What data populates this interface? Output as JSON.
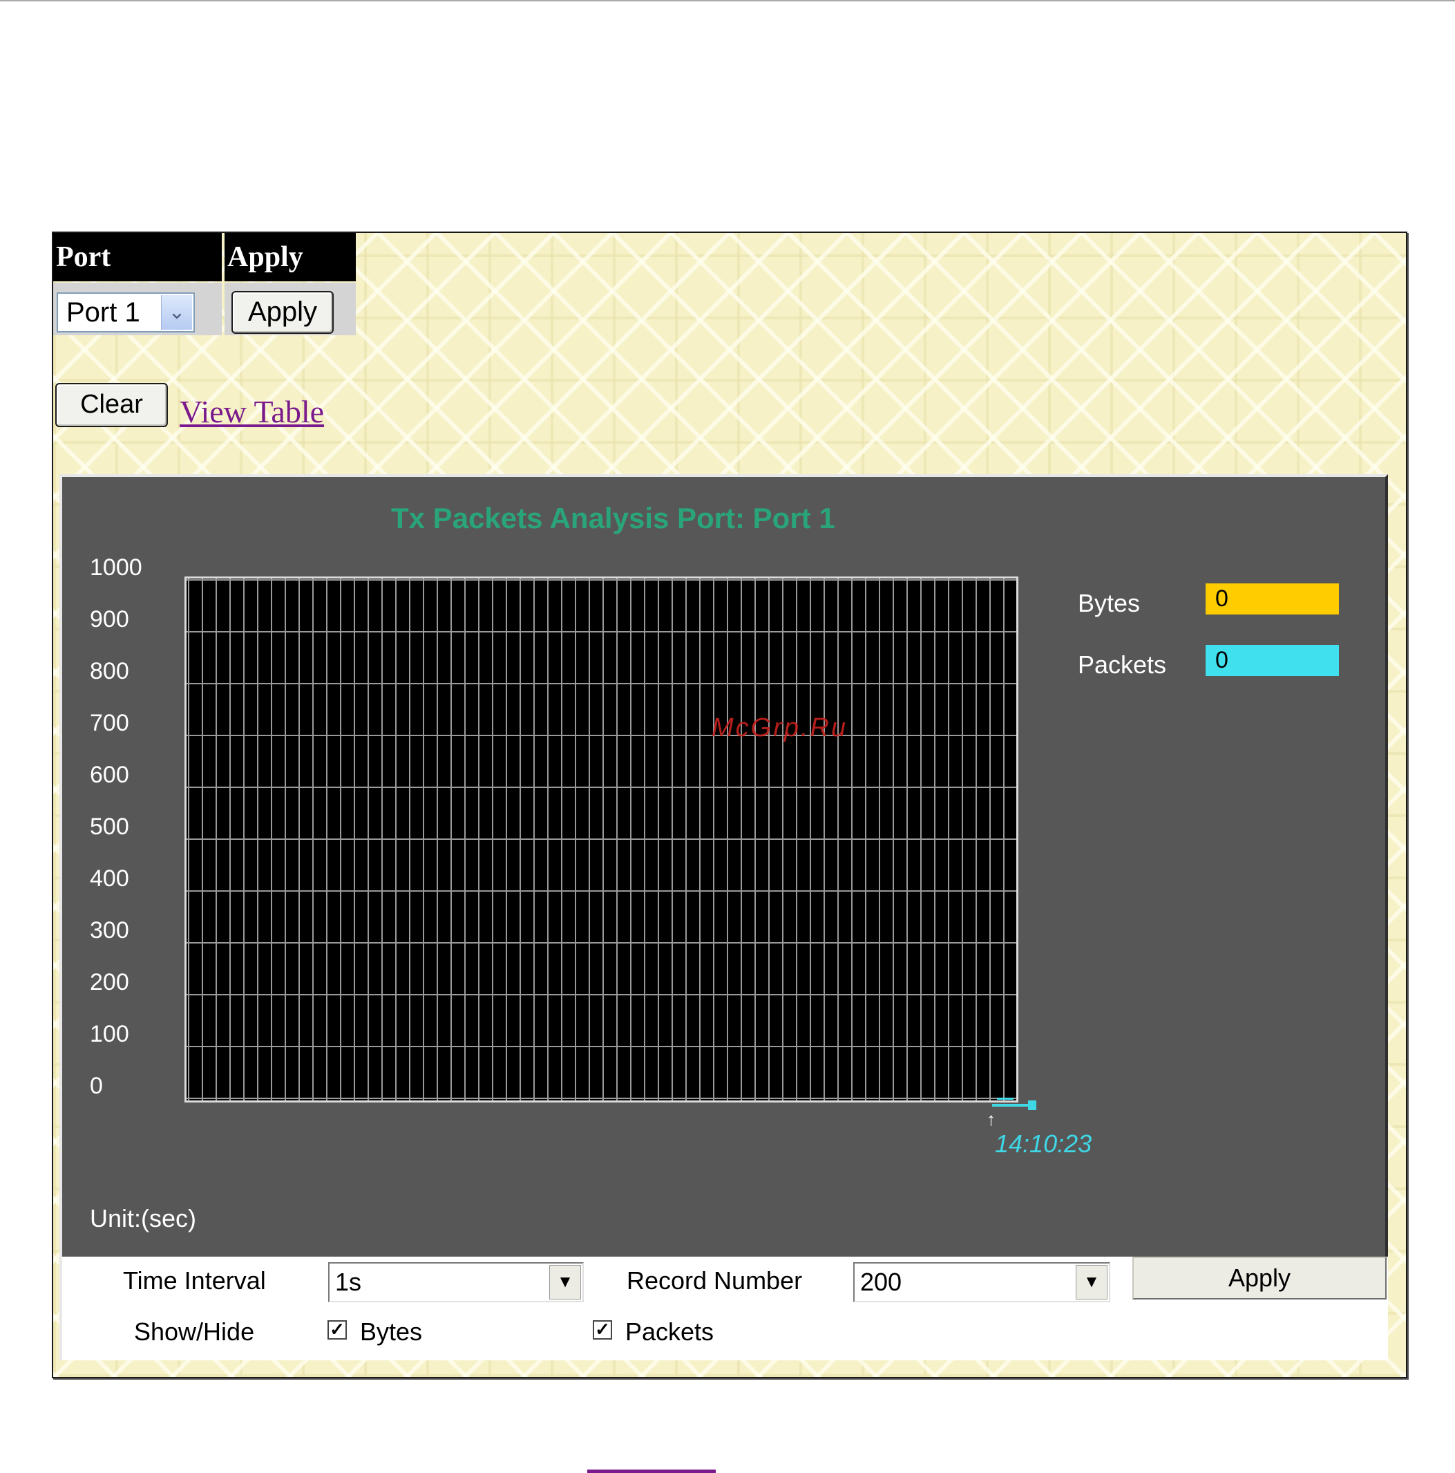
{
  "port_table": {
    "header_port": "Port",
    "header_apply": "Apply",
    "port_select_value": "Port 1",
    "apply_button": "Apply"
  },
  "actions": {
    "clear_button": "Clear",
    "view_table_link": "View Table"
  },
  "chart": {
    "title": "Tx Packets Analysis Port: Port 1",
    "time_label": "14:10:23",
    "unit_label": "Unit:(sec)"
  },
  "chart_data": {
    "type": "line",
    "title": "Tx Packets Analysis Port: Port 1",
    "xlabel": "Unit:(sec)",
    "ylabel": "",
    "y_ticks": [
      "1000",
      "900",
      "800",
      "700",
      "600",
      "500",
      "400",
      "300",
      "200",
      "100",
      "0"
    ],
    "ylim": [
      0,
      1000
    ],
    "x_last_tick": "14:10:23",
    "grid": true,
    "series": [
      {
        "name": "Bytes",
        "values": [
          0
        ],
        "color": "#ffcc00"
      },
      {
        "name": "Packets",
        "values": [
          0
        ],
        "color": "#40e0ee"
      }
    ]
  },
  "legend": {
    "items": [
      {
        "label": "Bytes",
        "value": "0",
        "color": "#ffcc00"
      },
      {
        "label": "Packets",
        "value": "0",
        "color": "#40e0ee"
      }
    ]
  },
  "controls": {
    "time_interval_label": "Time Interval",
    "time_interval_value": "1s",
    "record_number_label": "Record Number",
    "record_number_value": "200",
    "apply_button": "Apply",
    "show_hide_label": "Show/Hide",
    "bytes_checkbox_label": "Bytes",
    "packets_checkbox_label": "Packets",
    "bytes_checked": true,
    "packets_checked": true
  },
  "watermark": "McGrp.Ru"
}
